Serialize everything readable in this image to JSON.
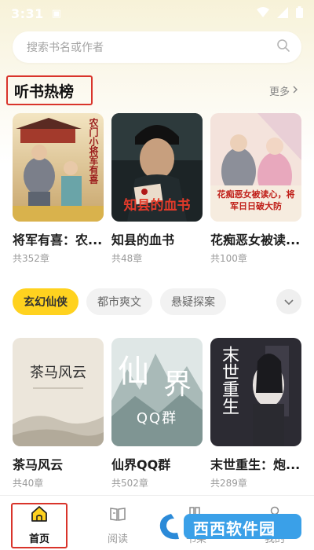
{
  "status_bar": {
    "time": "3:31"
  },
  "search": {
    "placeholder": "搜索书名或作者"
  },
  "hot_section": {
    "title": "听书热榜",
    "more_label": "更多",
    "books": [
      {
        "title": "将军有喜：农...",
        "chapters": "共352章",
        "cover_text": "农门小将军有喜"
      },
      {
        "title": "知县的血书",
        "chapters": "共48章",
        "cover_text": "知县的血书"
      },
      {
        "title": "花痴恶女被读...",
        "chapters": "共100章",
        "cover_text": "花痴恶女被读心，将军日日破大防"
      }
    ]
  },
  "category_tabs": {
    "tabs": [
      "玄幻仙侠",
      "都市爽文",
      "悬疑探案"
    ],
    "active_index": 0
  },
  "category_books": [
    {
      "title": "茶马风云",
      "chapters": "共40章",
      "cover_text": "茶马风云"
    },
    {
      "title": "仙界QQ群",
      "chapters": "共502章",
      "cover_text_a": "仙",
      "cover_text_b": "界",
      "cover_text_c": "QQ群"
    },
    {
      "title": "末世重生：炮...",
      "chapters": "共289章",
      "cover_text": "末世重生"
    }
  ],
  "bottom_nav": {
    "items": [
      {
        "label": "首页",
        "icon": "home-icon",
        "active": true
      },
      {
        "label": "阅读",
        "icon": "book-icon",
        "active": false
      },
      {
        "label": "书架",
        "icon": "shelf-icon",
        "active": false
      },
      {
        "label": "我的",
        "icon": "profile-icon",
        "active": false
      }
    ]
  },
  "watermark": {
    "text": "西西软件园"
  },
  "colors": {
    "accent": "#ffd21f",
    "highlight_box": "#d9342b"
  }
}
